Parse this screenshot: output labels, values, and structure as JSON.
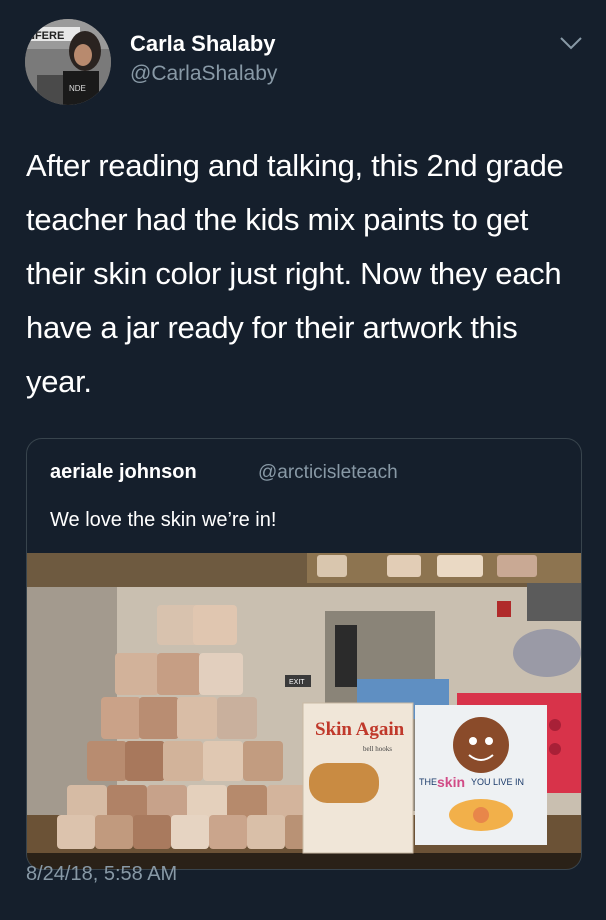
{
  "tweet": {
    "author_name": "Carla Shalaby",
    "author_handle": "@CarlaShalaby",
    "text": "After reading and talking, this 2nd grade teacher had the kids mix paints to get their skin color just right. Now they each have a jar ready for their artwork this year.",
    "timestamp": "8/24/18, 5:58 AM"
  },
  "quoted_tweet": {
    "author_name": "aeriale johnson",
    "author_handle": "@arcticisleteach",
    "text": "We love the skin we’re in!"
  },
  "photo": {
    "book1_title": "Skin Again",
    "book1_author": "bell hooks",
    "book2_title_pre": "THE",
    "book2_title_main": "skin",
    "book2_title_post": "YOU LIVE IN",
    "exit_sign": "EXIT"
  },
  "colors": {
    "background": "#151f2c",
    "secondary_text": "#8899a6",
    "border": "#38444d"
  },
  "icons": {
    "more_options": "chevron-down-icon"
  }
}
